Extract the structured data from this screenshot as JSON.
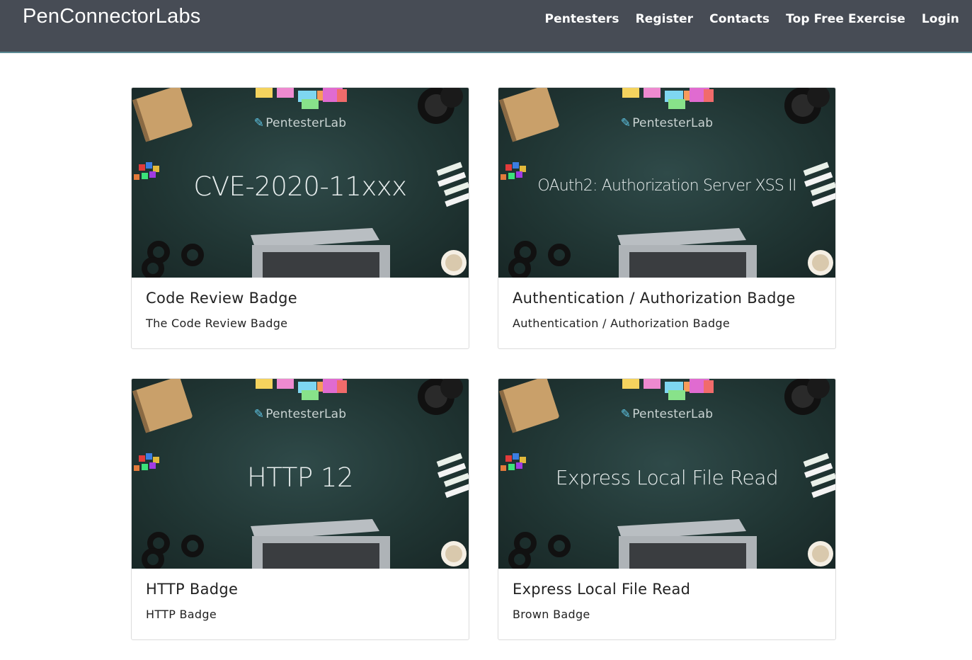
{
  "nav": {
    "brand": "PenConnectorLabs",
    "links": [
      "Pentesters",
      "Register",
      "Contacts",
      "Top Free Exercise",
      "Login"
    ]
  },
  "cards": [
    {
      "image_logo": "PentesterLab",
      "image_title": "CVE-2020-11xxx",
      "title": "Code Review Badge",
      "text": "The Code Review Badge"
    },
    {
      "image_logo": "PentesterLab",
      "image_title": "OAuth2: Authorization Server XSS II",
      "title": "Authentication / Authorization Badge",
      "text": "Authentication / Authorization Badge"
    },
    {
      "image_logo": "PentesterLab",
      "image_title": "HTTP 12",
      "title": "HTTP Badge",
      "text": "HTTP Badge"
    },
    {
      "image_logo": "PentesterLab",
      "image_title": "Express Local File Read",
      "title": "Express Local File Read",
      "text": "Brown Badge"
    }
  ]
}
